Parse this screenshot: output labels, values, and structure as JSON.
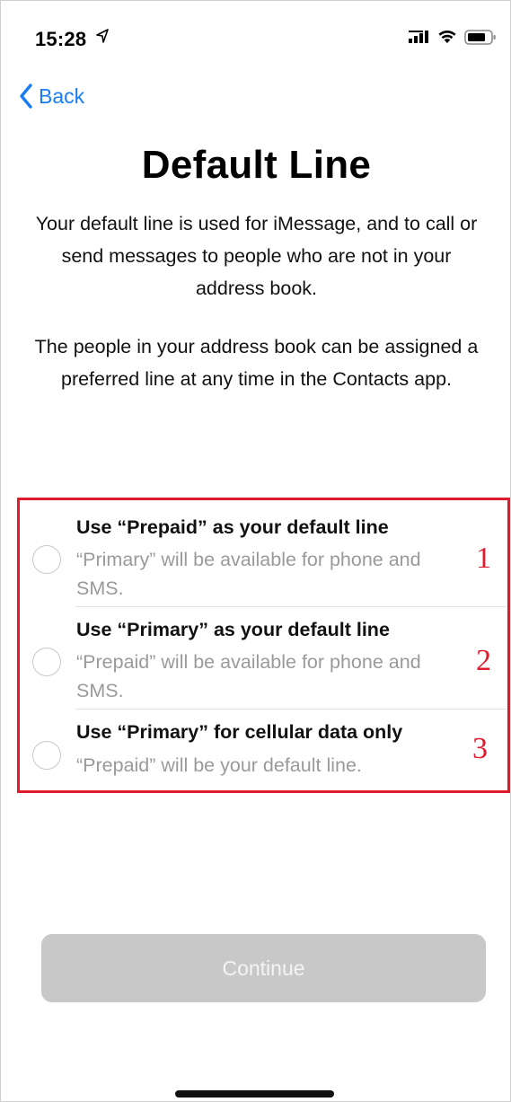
{
  "status_bar": {
    "time": "15:28",
    "icons": [
      "location-arrow-icon",
      "signal-icon",
      "wifi-icon",
      "battery-icon"
    ]
  },
  "nav": {
    "back_label": "Back"
  },
  "page": {
    "title": "Default Line",
    "intro_1": "Your default line is used for iMessage, and to call or send messages to people who are not in your address book.",
    "intro_2": "The people in your address book can be assigned a preferred line at any time in the Contacts app."
  },
  "options": [
    {
      "title": "Use “Prepaid” as your default line",
      "subtitle": "“Primary” will be available for phone and SMS.",
      "number": "1",
      "selected": false
    },
    {
      "title": "Use “Primary” as your default line",
      "subtitle": "“Prepaid” will be available for phone and SMS.",
      "number": "2",
      "selected": false
    },
    {
      "title": "Use “Primary” for cellular data only",
      "subtitle": "“Prepaid” will be your default line.",
      "number": "3",
      "selected": false
    }
  ],
  "continue": {
    "label": "Continue",
    "enabled": false
  },
  "colors": {
    "accent": "#1a7cf5",
    "annotation": "#e01b2d",
    "disabled_button": "#c8c8c8",
    "secondary_text": "#9a9a9a"
  }
}
